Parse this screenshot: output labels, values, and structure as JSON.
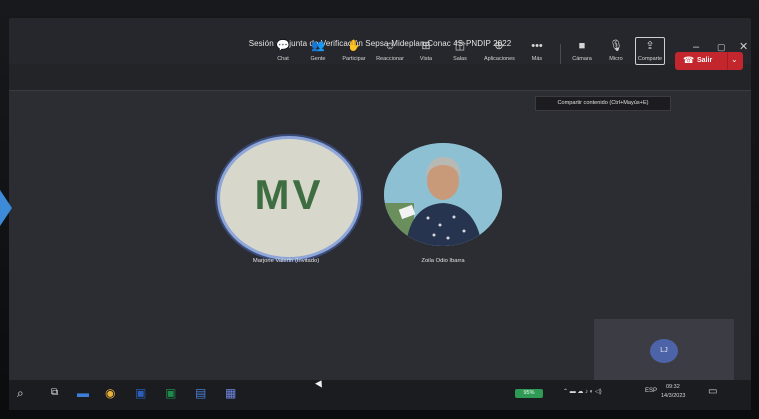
{
  "window": {
    "title": "Sesión conjunta de Verificación Sepsa-Mideplan-Conac 4S-PNDIP 2022",
    "minimize_icon": "minimize-icon",
    "maximize_icon": "maximize-icon",
    "close_icon": "close-icon"
  },
  "toolbar": {
    "chat": {
      "label": "Chat",
      "icon": "chat-icon"
    },
    "people": {
      "label": "Gente",
      "icon": "people-icon"
    },
    "participate": {
      "label": "Participar",
      "icon": "raise-hand-icon"
    },
    "react": {
      "label": "Reaccionar",
      "icon": "emoji-icon"
    },
    "view": {
      "label": "Vista",
      "icon": "grid-icon"
    },
    "rooms": {
      "label": "Salas",
      "icon": "rooms-icon"
    },
    "apps": {
      "label": "Aplicaciones",
      "icon": "apps-icon"
    },
    "more": {
      "label": "Más",
      "icon": "more-icon"
    },
    "camera": {
      "label": "Cámara",
      "icon": "camera-icon"
    },
    "mic": {
      "label": "Micro",
      "icon": "mic-icon"
    },
    "share": {
      "label": "Comparte",
      "icon": "share-icon"
    },
    "leave": {
      "label": "Salir",
      "icon": "phone-icon"
    }
  },
  "tooltip": "Compartir contenido (Ctrl+Mayús+E)",
  "participants": [
    {
      "initials": "MV",
      "name": "Marjorie Valerín (Invitado)"
    },
    {
      "name": "Zoila Odio Ibarra"
    }
  ],
  "self_view": {
    "initials": "LJ"
  },
  "taskbar": {
    "battery": "95%",
    "language": "ESP",
    "time": "09:32",
    "date": "14/3/2023"
  },
  "colors": {
    "accent": "#5b5fc7",
    "leave": "#c4262e",
    "mv_initials": "#3f6d42"
  }
}
